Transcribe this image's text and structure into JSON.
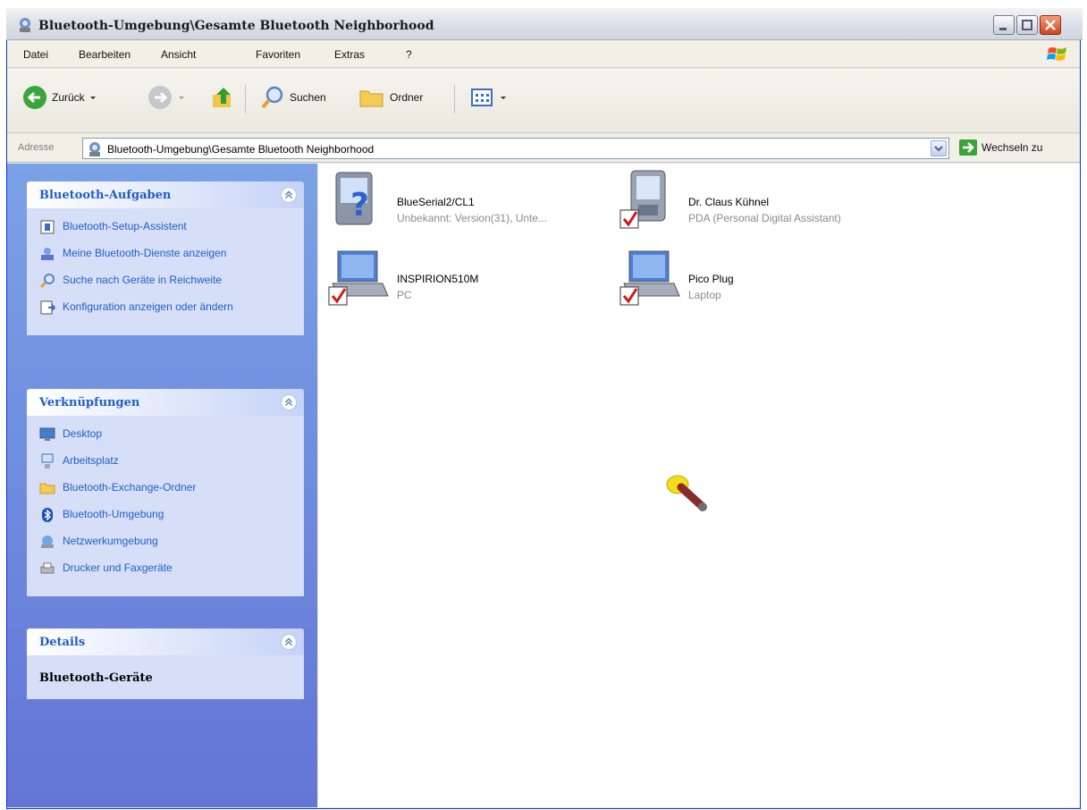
{
  "window": {
    "title": "Bluetooth-Umgebung\\Gesamte Bluetooth Neighborhood"
  },
  "menu": [
    "Datei",
    "Bearbeiten",
    "Ansicht",
    "Favoriten",
    "Extras",
    "?"
  ],
  "toolbar": {
    "back_label": "Zurück",
    "search_label": "Suchen",
    "folders_label": "Ordner"
  },
  "address": {
    "label": "Adresse",
    "value": "Bluetooth-Umgebung\\Gesamte Bluetooth Neighborhood",
    "go_label": "Wechseln zu"
  },
  "tasks_panel": {
    "title": "Bluetooth-Aufgaben",
    "items": [
      {
        "label": "Bluetooth-Setup-Assistent",
        "icon": "wizard-icon"
      },
      {
        "label": "Meine Bluetooth-Dienste anzeigen",
        "icon": "services-icon"
      },
      {
        "label": "Suche nach Geräte in Reichweite",
        "icon": "search-icon"
      },
      {
        "label": "Konfiguration anzeigen oder ändern",
        "icon": "config-icon"
      }
    ]
  },
  "links_panel": {
    "title": "Verknüpfungen",
    "items": [
      {
        "label": "Desktop",
        "icon": "desktop-icon"
      },
      {
        "label": "Arbeitsplatz",
        "icon": "computer-icon"
      },
      {
        "label": "Bluetooth-Exchange-Ordner",
        "icon": "folder-icon"
      },
      {
        "label": "Bluetooth-Umgebung",
        "icon": "bluetooth-icon"
      },
      {
        "label": "Netzwerkumgebung",
        "icon": "network-icon"
      },
      {
        "label": "Drucker und Faxgeräte",
        "icon": "printer-icon"
      }
    ]
  },
  "details_panel": {
    "title": "Details",
    "value": "Bluetooth-Geräte"
  },
  "devices": [
    {
      "name": "BlueSerial2/CL1",
      "type": "Unbekannt: Version(31), Unte...",
      "icon": "unknown-device-icon"
    },
    {
      "name": "Dr. Claus Kühnel",
      "type": "PDA (Personal Digital Assistant)",
      "icon": "pda-icon"
    },
    {
      "name": "INSPIRION510M",
      "type": "PC",
      "icon": "laptop-icon"
    },
    {
      "name": "Pico Plug",
      "type": "Laptop",
      "icon": "laptop-icon"
    }
  ],
  "colors": {
    "sidebar_top": "#7ba2e7",
    "sidebar_bottom": "#6375d6",
    "panel_title": "#215dc6",
    "panel_body": "#d6dff7",
    "subtext": "#8a8a8a"
  }
}
